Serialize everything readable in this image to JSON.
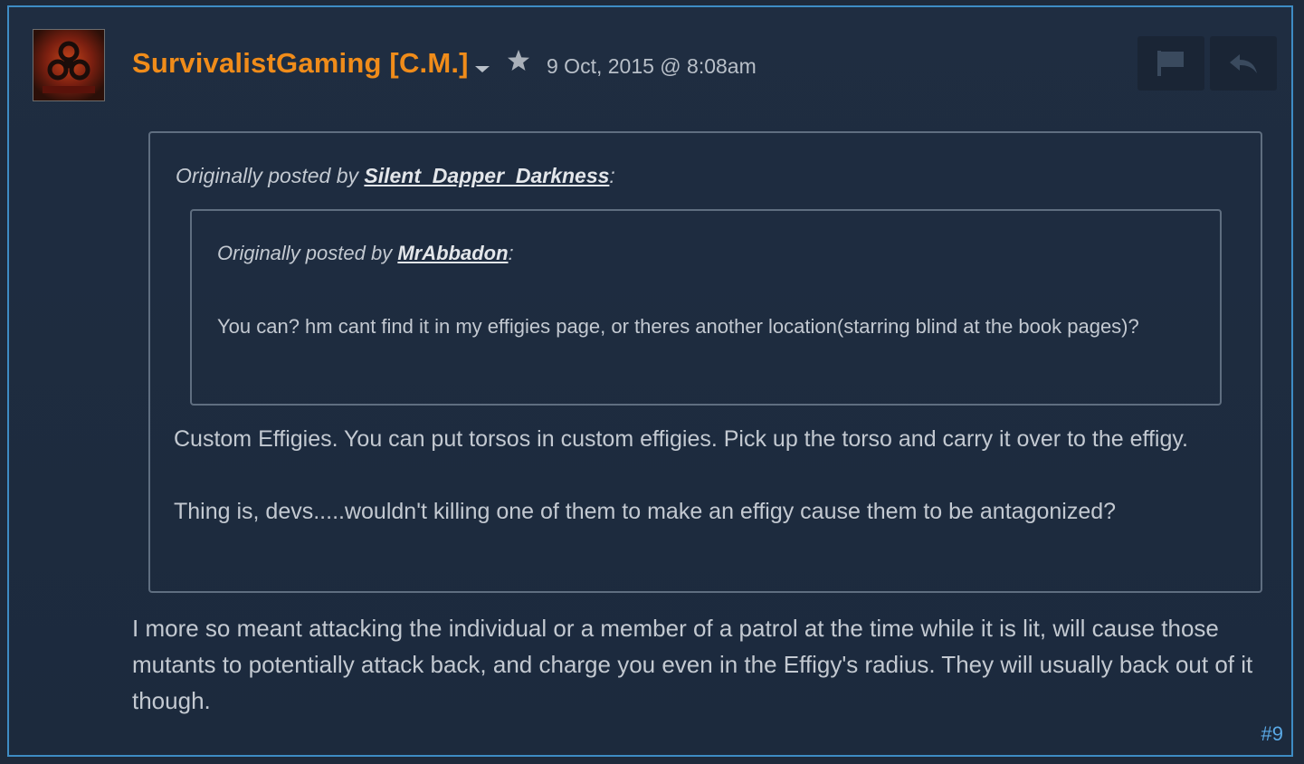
{
  "post": {
    "author": "SurvivalistGaming [C.M.]",
    "timestamp": "9 Oct, 2015 @ 8:08am",
    "post_number": "#9",
    "reply_text": "I more so meant attacking the individual or a member of a patrol at the time while it is lit, will cause those mutants to potentially attack back, and charge you even in the Effigy's radius. They will usually back out of it though."
  },
  "quote_outer": {
    "prefix": "Originally posted by ",
    "author": "Silent_Dapper_Darkness",
    "suffix": ":",
    "paragraphs": [
      "Custom Effigies. You can put torsos in custom effigies. Pick up the torso and carry it over to the effigy.",
      "Thing is, devs.....wouldn't killing one of them to make an effigy cause them to be antagonized?"
    ]
  },
  "quote_inner": {
    "prefix": "Originally posted by ",
    "author": "MrAbbadon",
    "suffix": ":",
    "text": "You can? hm cant find it in my effigies page, or theres another location(starring blind at the book pages)?"
  },
  "icons": {
    "avatar": "biohazard-avatar",
    "dropdown": "chevron-down-icon",
    "star": "star-icon",
    "flag": "flag-icon",
    "reply": "reply-icon"
  },
  "colors": {
    "author": "#f08c1a",
    "post_border": "#3e8cc4",
    "post_number": "#5aa9e6",
    "background": "#1e2a3b"
  }
}
